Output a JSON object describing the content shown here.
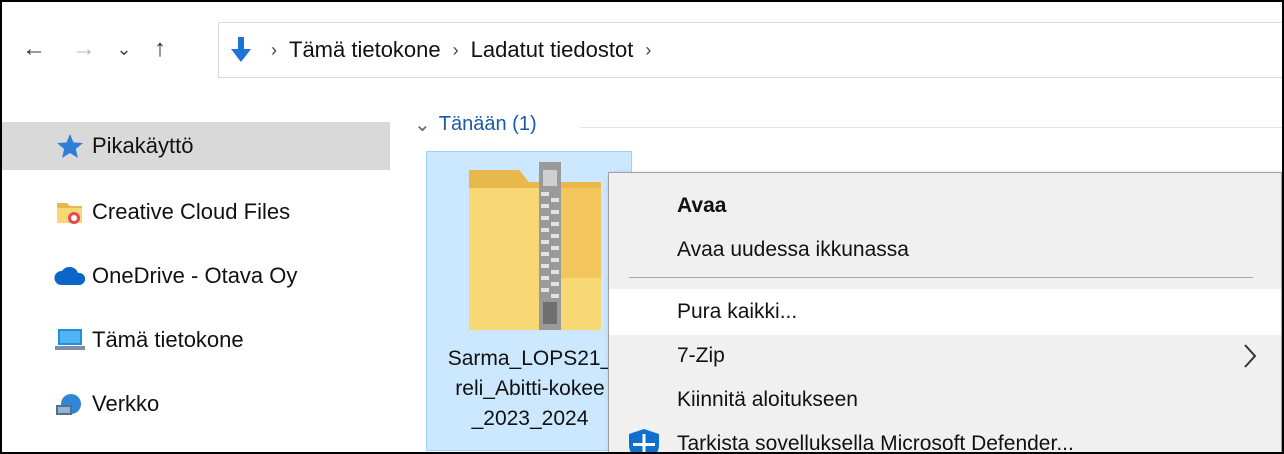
{
  "navigation": {
    "back_glyph": "←",
    "forward_glyph": "→",
    "recent_glyph": "⌄",
    "up_glyph": "↑"
  },
  "address": {
    "icon": "download-arrow-icon",
    "crumbs": [
      "Tämä tietokone",
      "Ladatut tiedostot"
    ],
    "separator": "›"
  },
  "sidebar": {
    "items": [
      {
        "label": "Pikakäyttö",
        "icon": "star-icon",
        "selected": true
      },
      {
        "label": "Creative Cloud Files",
        "icon": "creative-cloud-folder-icon"
      },
      {
        "label": "OneDrive - Otava Oy",
        "icon": "onedrive-cloud-icon"
      },
      {
        "label": "Tämä tietokone",
        "icon": "computer-icon"
      },
      {
        "label": "Verkko",
        "icon": "network-icon"
      }
    ]
  },
  "content": {
    "group_chevron": "⌄",
    "group_label": "Tänään (1)",
    "file": {
      "icon": "zip-folder-icon",
      "name_lines": [
        "Sarma_LOPS21_",
        "reli_Abitti-kokee",
        "_2023_2024"
      ]
    }
  },
  "context_menu": {
    "items": [
      {
        "label": "Avaa",
        "bold": true
      },
      {
        "label": "Avaa uudessa ikkunassa"
      },
      {
        "label": "Pura kaikki...",
        "hover": true
      },
      {
        "label": "7-Zip",
        "submenu": true
      },
      {
        "label": "Kiinnitä aloitukseen"
      },
      {
        "label": "Tarkista sovelluksella Microsoft Defender...",
        "icon": "defender-shield-icon"
      }
    ],
    "submenu_glyph": "›"
  },
  "colors": {
    "selection_fill": "#cce8ff",
    "selection_border": "#99d1ff",
    "sidebar_selected": "#d9d9d9",
    "menu_bg": "#f0f0f0",
    "accent_blue": "#1a5aa6",
    "folder_yellow": "#f8d775"
  }
}
